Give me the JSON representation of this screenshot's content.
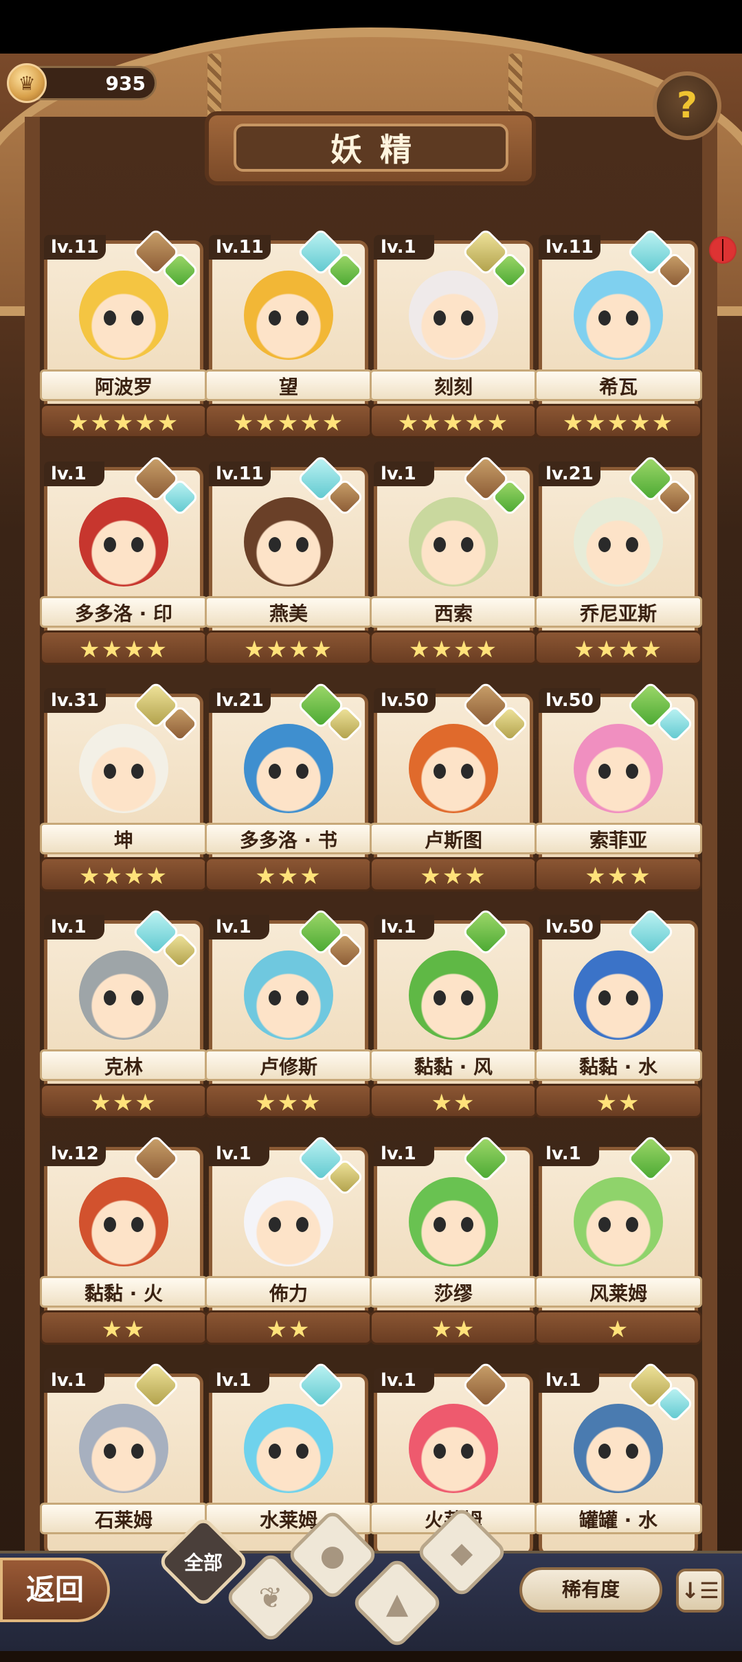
{
  "header": {
    "coins": "935",
    "title": "妖精",
    "help_icon": "question-mark-icon"
  },
  "cards": [
    {
      "level": "lv.11",
      "name": "阿波罗",
      "stars": 5,
      "elements": [
        "gem",
        "leaf"
      ],
      "color": "#f4c542"
    },
    {
      "level": "lv.11",
      "name": "望",
      "stars": 5,
      "elements": [
        "water",
        "leaf"
      ],
      "color": "#f2b736"
    },
    {
      "level": "lv.1",
      "name": "刻刻",
      "stars": 5,
      "elements": [
        "stone",
        "leaf"
      ],
      "color": "#efeaea"
    },
    {
      "level": "lv.11",
      "name": "希瓦",
      "stars": 5,
      "elements": [
        "water",
        "gem"
      ],
      "color": "#7fd0ef"
    },
    {
      "level": "lv.1",
      "name": "多多洛 · 印",
      "stars": 4,
      "elements": [
        "gem",
        "water"
      ],
      "color": "#c7362e"
    },
    {
      "level": "lv.11",
      "name": "燕美",
      "stars": 4,
      "elements": [
        "water",
        "gem"
      ],
      "color": "#6a4028"
    },
    {
      "level": "lv.1",
      "name": "西索",
      "stars": 4,
      "elements": [
        "gem",
        "leaf"
      ],
      "color": "#c9d89e"
    },
    {
      "level": "lv.21",
      "name": "乔尼亚斯",
      "stars": 4,
      "elements": [
        "leaf",
        "gem"
      ],
      "color": "#e7ecd8"
    },
    {
      "level": "lv.31",
      "name": "坤",
      "stars": 4,
      "elements": [
        "stone",
        "gem"
      ],
      "color": "#f3f0e6"
    },
    {
      "level": "lv.21",
      "name": "多多洛 · 书",
      "stars": 3,
      "elements": [
        "leaf",
        "stone"
      ],
      "color": "#3f8fcf"
    },
    {
      "level": "lv.50",
      "name": "卢斯图",
      "stars": 3,
      "elements": [
        "gem",
        "stone"
      ],
      "color": "#e06a2c"
    },
    {
      "level": "lv.50",
      "name": "索菲亚",
      "stars": 3,
      "elements": [
        "leaf",
        "water"
      ],
      "color": "#f08fc0"
    },
    {
      "level": "lv.1",
      "name": "克林",
      "stars": 3,
      "elements": [
        "water",
        "stone"
      ],
      "color": "#9ea5a8"
    },
    {
      "level": "lv.1",
      "name": "卢修斯",
      "stars": 3,
      "elements": [
        "leaf",
        "gem"
      ],
      "color": "#6fc8df"
    },
    {
      "level": "lv.1",
      "name": "黏黏 · 风",
      "stars": 2,
      "elements": [
        "leaf"
      ],
      "color": "#5fb845"
    },
    {
      "level": "lv.50",
      "name": "黏黏 · 水",
      "stars": 2,
      "elements": [
        "water"
      ],
      "color": "#3b73c8"
    },
    {
      "level": "lv.12",
      "name": "黏黏 · 火",
      "stars": 2,
      "elements": [
        "gem"
      ],
      "color": "#d2522e"
    },
    {
      "level": "lv.1",
      "name": "佈力",
      "stars": 2,
      "elements": [
        "water",
        "stone"
      ],
      "color": "#f4f4f8"
    },
    {
      "level": "lv.1",
      "name": "莎缪",
      "stars": 2,
      "elements": [
        "leaf"
      ],
      "color": "#69c251"
    },
    {
      "level": "lv.1",
      "name": "风莱姆",
      "stars": 1,
      "elements": [
        "leaf"
      ],
      "color": "#8fd36b"
    },
    {
      "level": "lv.1",
      "name": "石莱姆",
      "stars": 0,
      "elements": [
        "stone"
      ],
      "color": "#a7b0bf"
    },
    {
      "level": "lv.1",
      "name": "水莱姆",
      "stars": 0,
      "elements": [
        "water"
      ],
      "color": "#6fd2ec"
    },
    {
      "level": "lv.1",
      "name": "火莱姆",
      "stars": 0,
      "elements": [
        "gem"
      ],
      "color": "#ee5a6e"
    },
    {
      "level": "lv.1",
      "name": "罐罐 · 水",
      "stars": 0,
      "elements": [
        "stone",
        "water"
      ],
      "color": "#4a7bb0"
    }
  ],
  "bottom": {
    "back_label": "返回",
    "filter_all_label": "全部",
    "rarity_label": "稀有度",
    "sort_label": "↓☰"
  }
}
